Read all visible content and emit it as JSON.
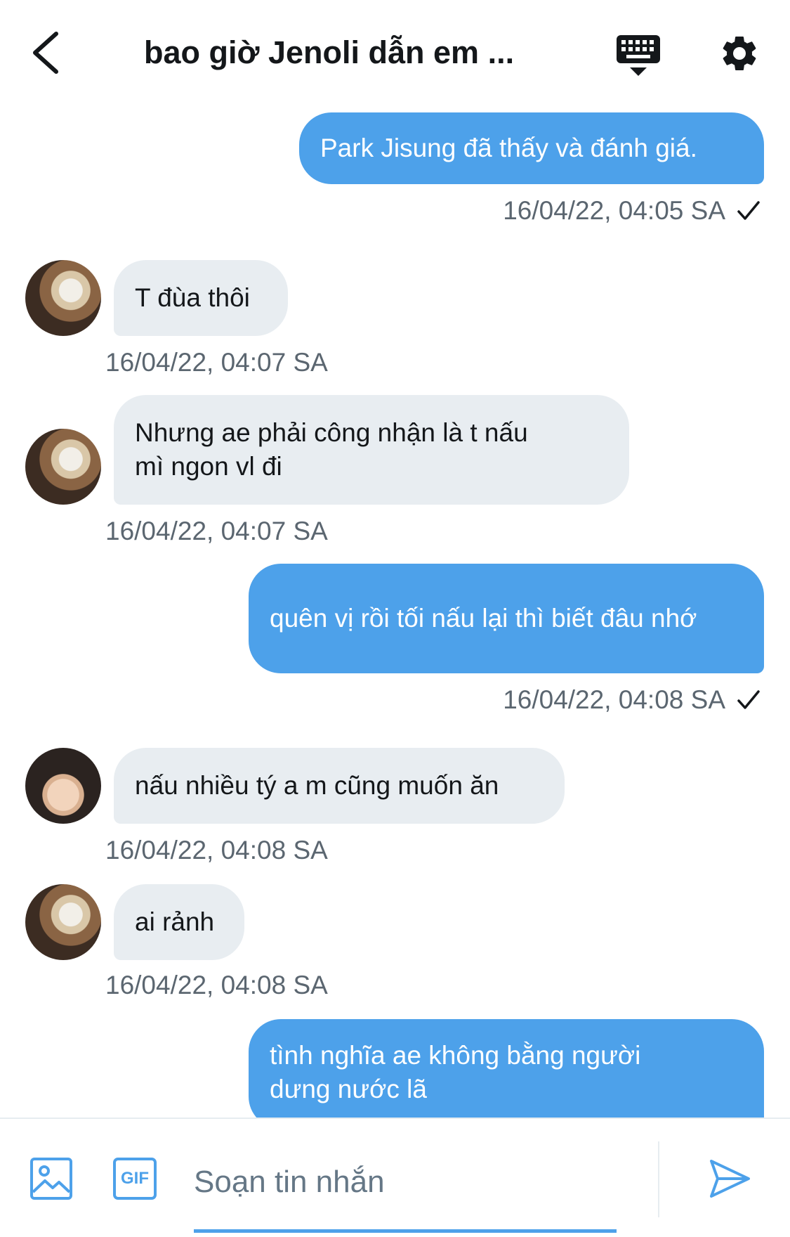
{
  "header": {
    "title": "bao giờ Jenoli dẫn em ...",
    "back_icon": "chevron-left-icon",
    "keyboard_icon": "keyboard-icon",
    "settings_icon": "gear-icon"
  },
  "messages": [
    {
      "direction": "out",
      "text": "Park Jisung đã thấy và đánh giá.",
      "time": "16/04/22, 04:05 SA",
      "read": true
    },
    {
      "direction": "in",
      "text": "T đùa thôi",
      "time": "16/04/22, 04:07 SA"
    },
    {
      "direction": "in",
      "text": "Nhưng ae phải công nhận là t nấu mì ngon vl đi",
      "time": "16/04/22, 04:07 SA"
    },
    {
      "direction": "out",
      "text": "quên vị rồi tối nấu lại thì biết đâu nhớ",
      "time": "16/04/22, 04:08 SA",
      "read": true
    },
    {
      "direction": "in",
      "text": "nấu nhiều tý a m cũng muốn ăn",
      "time": "16/04/22, 04:08 SA"
    },
    {
      "direction": "in",
      "text": "ai rảnh",
      "time": "16/04/22, 04:08 SA"
    },
    {
      "direction": "out",
      "text": "tình nghĩa ae không bằng người dưng nước lã"
    }
  ],
  "composer": {
    "placeholder": "Soạn tin nhắn",
    "image_icon": "image-icon",
    "gif_label": "GIF",
    "send_icon": "send-icon"
  },
  "colors": {
    "outgoing_bubble": "#4da1ea",
    "incoming_bubble": "#e8edf1",
    "accent": "#4da1ea"
  }
}
